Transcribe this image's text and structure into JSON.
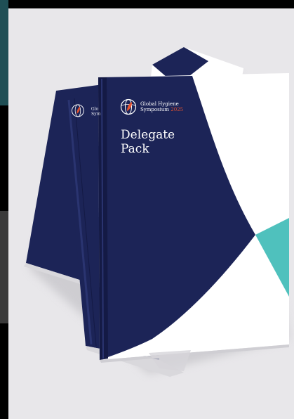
{
  "cover": {
    "org_line1": "Global Hygiene",
    "org_line2": "Symposium",
    "year": "2025",
    "title": "Delegate\nPack"
  },
  "back_cover": {
    "org_line1": "Glo",
    "org_line2": "Sym"
  },
  "colors": {
    "navy": "#1c2457",
    "teal": "#4fc1bd",
    "accent": "#e8532f",
    "background": "#e8e7ea"
  }
}
